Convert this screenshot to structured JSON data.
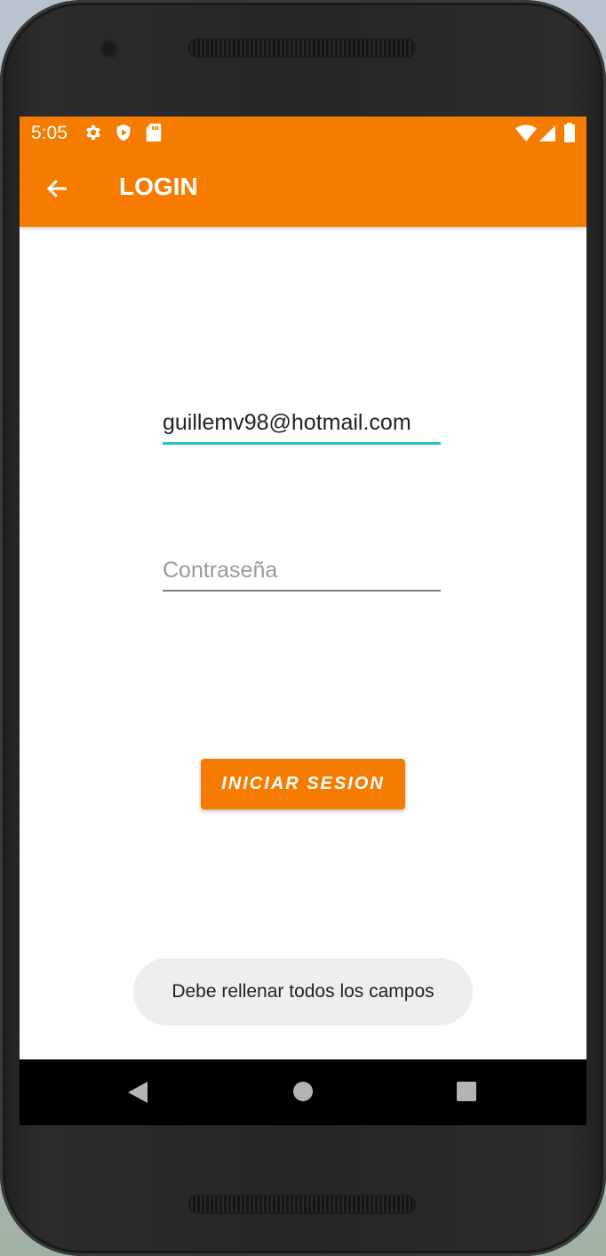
{
  "status_bar": {
    "time": "5:05",
    "icons": [
      "settings-icon",
      "shield-icon",
      "sd-card-icon",
      "wifi-icon",
      "signal-icon",
      "battery-icon"
    ]
  },
  "app_bar": {
    "title": "LOGIN",
    "back_icon": "arrow-left-icon"
  },
  "form": {
    "email_value": "guillemv98@hotmail.com",
    "password_placeholder": "Contraseña",
    "submit_label": "INICIAR SESION"
  },
  "toast": {
    "message": "Debe rellenar todos los campos"
  },
  "nav_bar": {
    "icons": [
      "back-triangle-icon",
      "home-circle-icon",
      "recents-square-icon"
    ]
  },
  "colors": {
    "primary": "#f57c00",
    "accent": "#26c6c6"
  }
}
